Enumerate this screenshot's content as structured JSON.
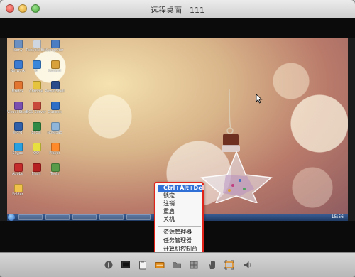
{
  "window": {
    "title": "远程桌面　111"
  },
  "desktop": {
    "icons": [
      {
        "label": "Ivony",
        "color": "#6b8fc0"
      },
      {
        "label": "Recycle Bin",
        "color": "#cfd6df"
      },
      {
        "label": "Computer",
        "color": "#4a7dc2"
      },
      {
        "label": "Network",
        "color": "#3b7bd1"
      },
      {
        "label": "IE",
        "color": "#3a86d8"
      },
      {
        "label": "Control",
        "color": "#d8a13a"
      },
      {
        "label": "Firefox",
        "color": "#e2752f"
      },
      {
        "label": "Chrome",
        "color": "#e6c33c"
      },
      {
        "label": "PowerShell",
        "color": "#2a4c8a"
      },
      {
        "label": "Visual Studio",
        "color": "#7a4fb0"
      },
      {
        "label": "SQL Server",
        "color": "#c84a3a"
      },
      {
        "label": "Outlook",
        "color": "#2f6ec6"
      },
      {
        "label": "Word",
        "color": "#2e5fa8"
      },
      {
        "label": "Excel",
        "color": "#2f8a45"
      },
      {
        "label": "Notepad",
        "color": "#8fb6d8"
      },
      {
        "label": "Skype",
        "color": "#2aa0e0"
      },
      {
        "label": "QQ",
        "color": "#e8e040"
      },
      {
        "label": "Player",
        "color": "#ff8a2a"
      },
      {
        "label": "Adobe",
        "color": "#c52b2b"
      },
      {
        "label": "Flash",
        "color": "#b52020"
      },
      {
        "label": "Tools",
        "color": "#5a9b4a"
      },
      {
        "label": "Folder",
        "color": "#f0c24a"
      }
    ],
    "taskbar_time": "15:56"
  },
  "context_menu": {
    "items": [
      {
        "label": "Ctrl+Alt+Del",
        "selected": true
      },
      {
        "label": "锁定"
      },
      {
        "label": "注销"
      },
      {
        "label": "重启"
      },
      {
        "label": "关机"
      },
      {
        "label": "资源管理器"
      },
      {
        "label": "任务管理器"
      },
      {
        "label": "计算机控制台"
      }
    ]
  },
  "toolbar": {
    "buttons": [
      {
        "icon": "info-icon"
      },
      {
        "icon": "display-icon"
      },
      {
        "icon": "clipboard-icon"
      },
      {
        "icon": "keyboard-icon"
      },
      {
        "icon": "folder-icon"
      },
      {
        "icon": "mouse-icon"
      },
      {
        "icon": "grid-icon"
      },
      {
        "icon": "hand-icon"
      },
      {
        "icon": "fullscreen-icon"
      },
      {
        "icon": "speaker-icon"
      }
    ],
    "accent": "#e08a1a"
  },
  "colors": {
    "menu_border": "#e2231a",
    "menu_selection": "#2f6fd6"
  }
}
